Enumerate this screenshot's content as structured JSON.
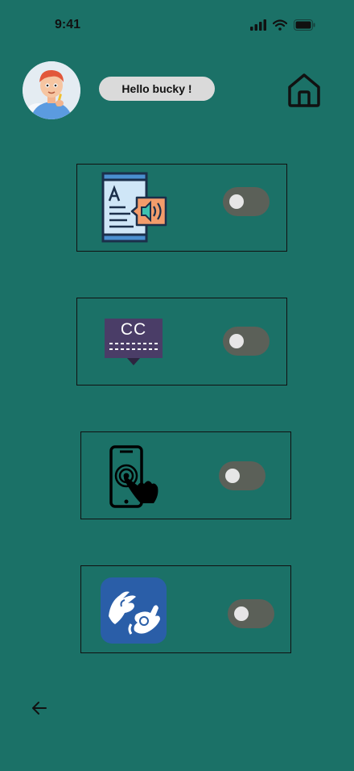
{
  "status_bar": {
    "time": "9:41"
  },
  "header": {
    "greeting": "Hello bucky !"
  },
  "features": [
    {
      "icon": "text-to-speech-icon",
      "enabled": false
    },
    {
      "icon": "closed-captions-icon",
      "caption_text": "CC",
      "enabled": false
    },
    {
      "icon": "touch-screen-icon",
      "enabled": false
    },
    {
      "icon": "sign-language-icon",
      "enabled": false
    }
  ],
  "colors": {
    "background": "#1b7167",
    "toggle_track": "#5b6058",
    "toggle_knob": "#e6e6e6",
    "greeting_pill": "#dadada",
    "cc_badge": "#4a3d67",
    "sign_language_tile": "#2a5ea8"
  }
}
